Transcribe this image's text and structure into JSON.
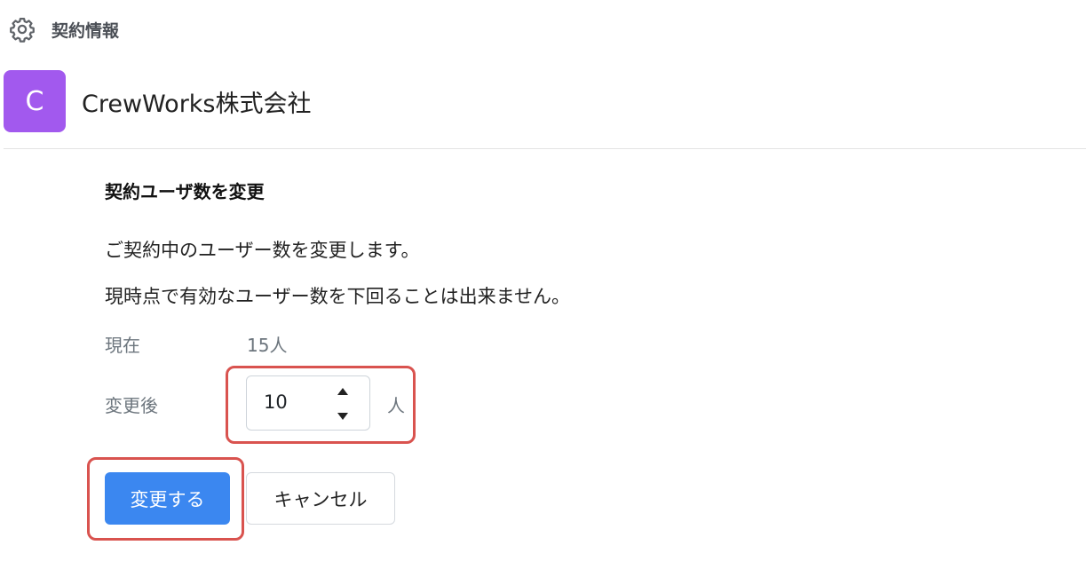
{
  "header": {
    "title": "契約情報",
    "icon": "gear-icon"
  },
  "company": {
    "avatar_letter": "C",
    "avatar_color": "#a259ee",
    "name": "CrewWorks株式会社"
  },
  "form": {
    "title": "契約ユーザ数を変更",
    "description_1": "ご契約中のユーザー数を変更します。",
    "description_2": "現時点で有効なユーザー数を下回ることは出来ません。",
    "current_label": "現在",
    "current_value": "15人",
    "after_label": "変更後",
    "after_value": "10",
    "after_unit": "人"
  },
  "actions": {
    "submit_label": "変更する",
    "cancel_label": "キャンセル"
  },
  "colors": {
    "primary": "#3b87f0",
    "highlight": "#d9534f"
  }
}
